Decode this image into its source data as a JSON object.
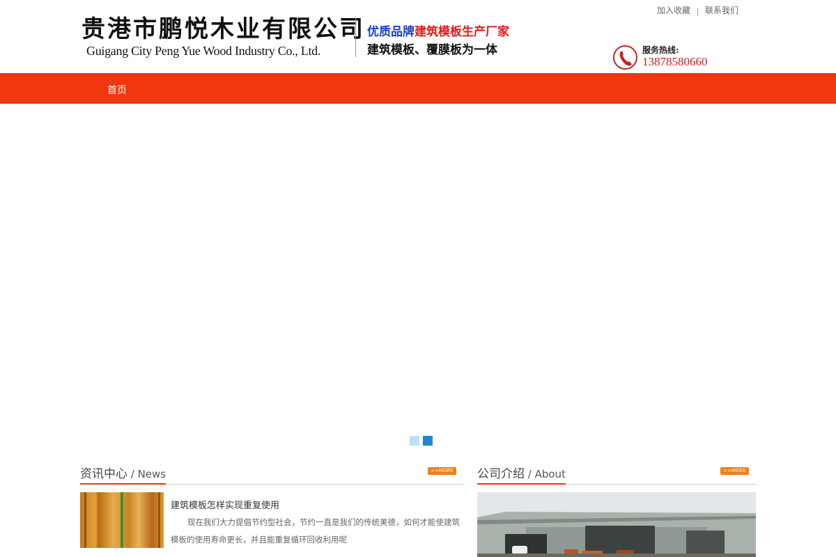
{
  "header": {
    "logo_cn": "贵港市鹏悦木业有限公司",
    "logo_en": "Guigang City Peng Yue Wood Industry Co., Ltd.",
    "slogan_blue": "优质品牌",
    "slogan_red": "建筑模板生产厂家",
    "slogan_line2": "建筑模板、覆膜板为一体",
    "links": [
      "加入收藏",
      "联系我们"
    ],
    "hotline_label": "服务热线:",
    "hotline_number": "13878580660"
  },
  "nav": {
    "items": [
      "首页"
    ]
  },
  "banner": {
    "slides": 2,
    "active_slide": 2
  },
  "news": {
    "title": "资讯中心",
    "subtitle": " / News",
    "more": ">>MORE",
    "item": {
      "title": "建筑模板怎样实现重复使用",
      "desc": "现在我们大力提倡节约型社会，节约一直是我们的传统美德，如何才能使建筑模板的使用寿命更长，并且能重复循环回收利用呢"
    }
  },
  "about": {
    "title": "公司介绍",
    "subtitle": " / About",
    "more": ">>MORE"
  },
  "colors": {
    "nav": "#f0370f",
    "accent_more": "#f07f10",
    "dot_active": "#1f87d0",
    "dot_inactive": "#b9e2f7",
    "hotline": "#c8201e"
  },
  "icons": [
    "phone-icon"
  ]
}
